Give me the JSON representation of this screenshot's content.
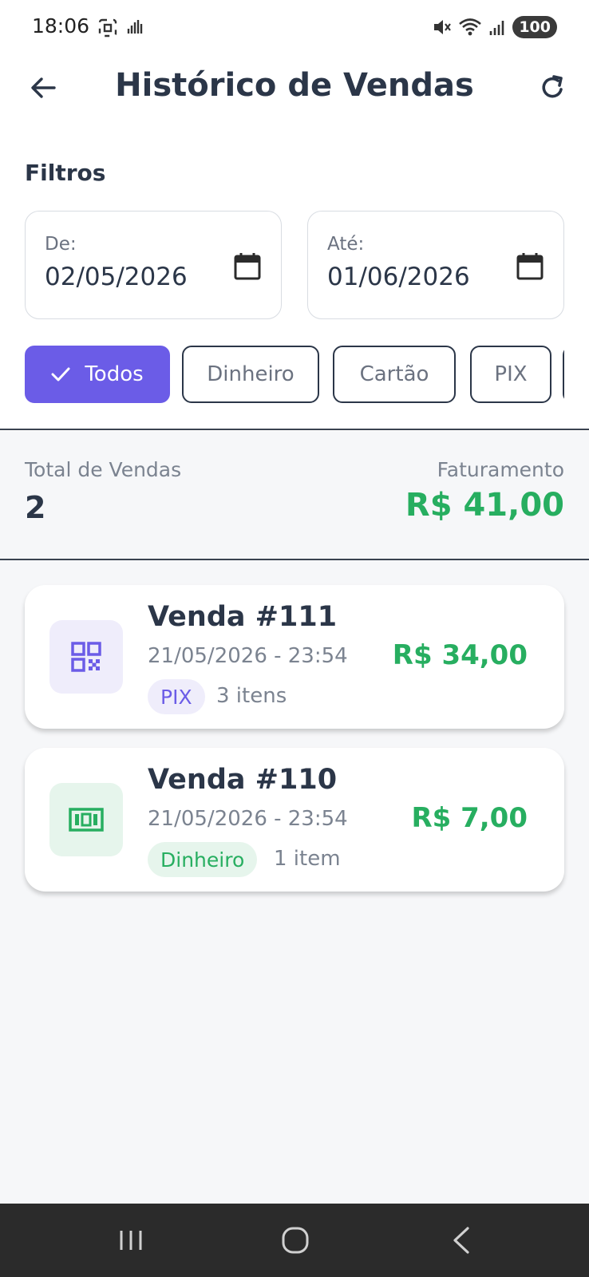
{
  "status_bar": {
    "time": "18:06",
    "battery": "100",
    "icons": [
      "screenshot-icon",
      "signal-waves-icon",
      "mute-icon",
      "wifi-icon",
      "cell-signal-icon"
    ]
  },
  "app_bar": {
    "title": "Histórico de Vendas",
    "back_icon": "arrow-left-icon",
    "refresh_icon": "refresh-icon"
  },
  "filters": {
    "label": "Filtros",
    "date_from": {
      "label": "De:",
      "value": "02/05/2026"
    },
    "date_to": {
      "label": "Até:",
      "value": "01/06/2026"
    },
    "chips": [
      {
        "label": "Todos",
        "selected": true
      },
      {
        "label": "Dinheiro",
        "selected": false
      },
      {
        "label": "Cartão",
        "selected": false
      },
      {
        "label": "PIX",
        "selected": false
      }
    ]
  },
  "summary": {
    "total_label": "Total de Vendas",
    "total_value": "2",
    "revenue_label": "Faturamento",
    "revenue_value": "R$  41,00"
  },
  "sales": [
    {
      "title": "Venda #111",
      "datetime": "21/05/2026 - 23:54",
      "method": "PIX",
      "items": "3 itens",
      "value": "R$  34,00",
      "icon": "qr-code-icon"
    },
    {
      "title": "Venda #110",
      "datetime": "21/05/2026 - 23:54",
      "method": "Dinheiro",
      "items": "1 item",
      "value": "R$  7,00",
      "icon": "cash-icon"
    }
  ],
  "colors": {
    "primary": "#6b5ce7",
    "success": "#27ae60",
    "text": "#2b3648",
    "muted": "#7b8390"
  }
}
